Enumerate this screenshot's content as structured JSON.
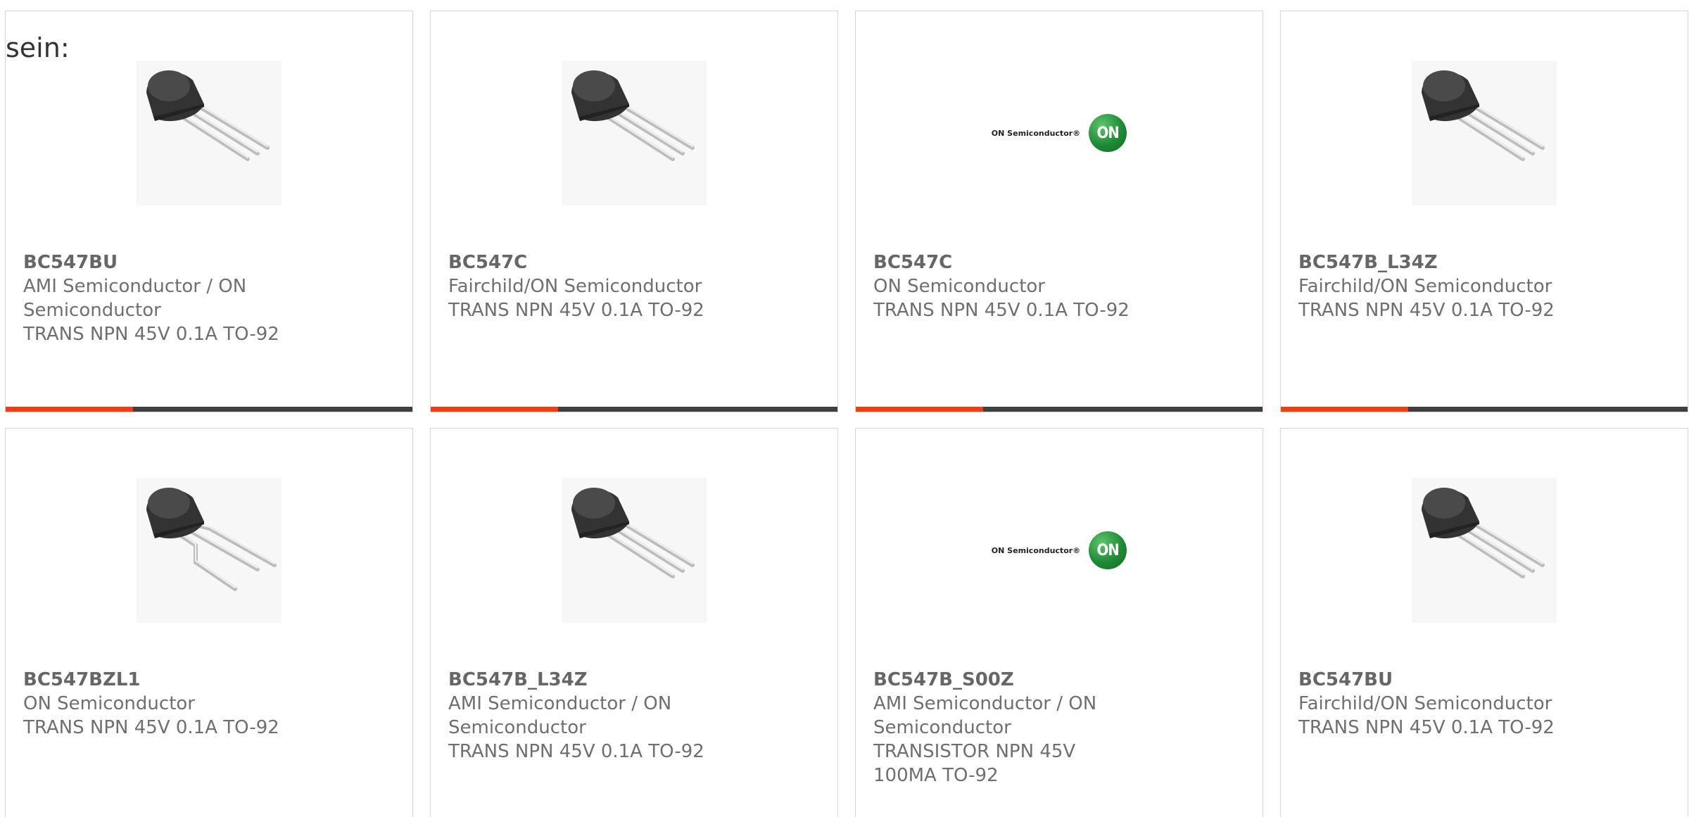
{
  "intro_text": "sein:",
  "colors": {
    "accent": "#e8401c",
    "bar": "#3f3f3f",
    "border": "#d4d4d4",
    "text": "#6f6f6f"
  },
  "products": [
    {
      "part": "BC547BU",
      "manufacturer": "AMI Semiconductor / ON Semiconductor",
      "description": "TRANS NPN 45V 0.1A TO-92",
      "image": "transistor-to92-photo"
    },
    {
      "part": "BC547C",
      "manufacturer": "Fairchild/ON Semiconductor",
      "description": "TRANS NPN 45V 0.1A TO-92",
      "image": "transistor-to92-photo"
    },
    {
      "part": "BC547C",
      "manufacturer": "ON Semiconductor",
      "description": "TRANS NPN 45V 0.1A TO-92",
      "image": "on-semiconductor-logo",
      "logo_text": "ON Semiconductor®",
      "logo_badge": "ON"
    },
    {
      "part": "BC547B_L34Z",
      "manufacturer": "Fairchild/ON Semiconductor",
      "description": "TRANS NPN 45V 0.1A TO-92",
      "image": "transistor-to92-photo"
    },
    {
      "part": "BC547BZL1",
      "manufacturer": "ON Semiconductor",
      "description": "TRANS NPN 45V 0.1A TO-92",
      "image": "transistor-to92-bent-leads-photo"
    },
    {
      "part": "BC547B_L34Z",
      "manufacturer": "AMI Semiconductor / ON Semiconductor",
      "description": "TRANS NPN 45V 0.1A TO-92",
      "image": "transistor-to92-photo"
    },
    {
      "part": "BC547B_S00Z",
      "manufacturer": "AMI Semiconductor / ON Semiconductor",
      "description": "TRANSISTOR NPN 45V 100MA TO-92",
      "image": "on-semiconductor-logo",
      "logo_text": "ON Semiconductor®",
      "logo_badge": "ON"
    },
    {
      "part": "BC547BU",
      "manufacturer": "Fairchild/ON Semiconductor",
      "description": "TRANS NPN 45V 0.1A TO-92",
      "image": "transistor-to92-photo"
    }
  ]
}
